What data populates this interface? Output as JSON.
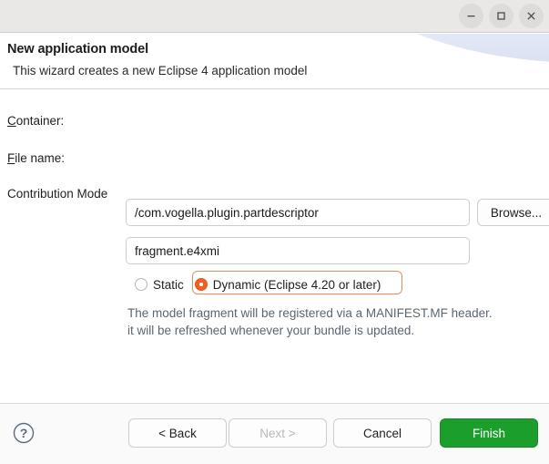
{
  "window": {
    "controls": [
      {
        "name": "minimize-button",
        "icon": "minimize-icon",
        "label": "—"
      },
      {
        "name": "maximize-button",
        "icon": "maximize-icon",
        "label": "□"
      },
      {
        "name": "close-button",
        "icon": "close-icon",
        "label": "×"
      }
    ]
  },
  "header": {
    "title": "New application model",
    "description": "This wizard creates a new Eclipse 4 application model"
  },
  "form": {
    "container": {
      "label_prefix": "",
      "label_mnemonic": "C",
      "label_suffix": "ontainer:",
      "value": "/com.vogella.plugin.partdescriptor",
      "placeholder": ""
    },
    "file_name": {
      "label_prefix": "",
      "label_mnemonic": "F",
      "label_suffix": "ile name:",
      "value": "fragment.e4xmi",
      "placeholder": ""
    },
    "browse_label": "Browse...",
    "contribution_mode": {
      "label": "Contribution Mode",
      "options": [
        {
          "label": "Static",
          "checked": false
        },
        {
          "label": "Dynamic (Eclipse 4.20 or later)",
          "checked": true
        }
      ],
      "hint": "The model fragment will be registered via a MANIFEST.MF header.\nit will be refreshed whenever your bundle is updated."
    }
  },
  "footer": {
    "help_label": "?",
    "buttons": {
      "back": "< Back",
      "next": "Next >",
      "cancel": "Cancel",
      "finish": "Finish"
    }
  },
  "colors": {
    "accent_orange": "#ed6023",
    "primary_green": "#1c9e2c",
    "titlebar": "#e9e8e7",
    "hint_text": "#5a6672"
  }
}
